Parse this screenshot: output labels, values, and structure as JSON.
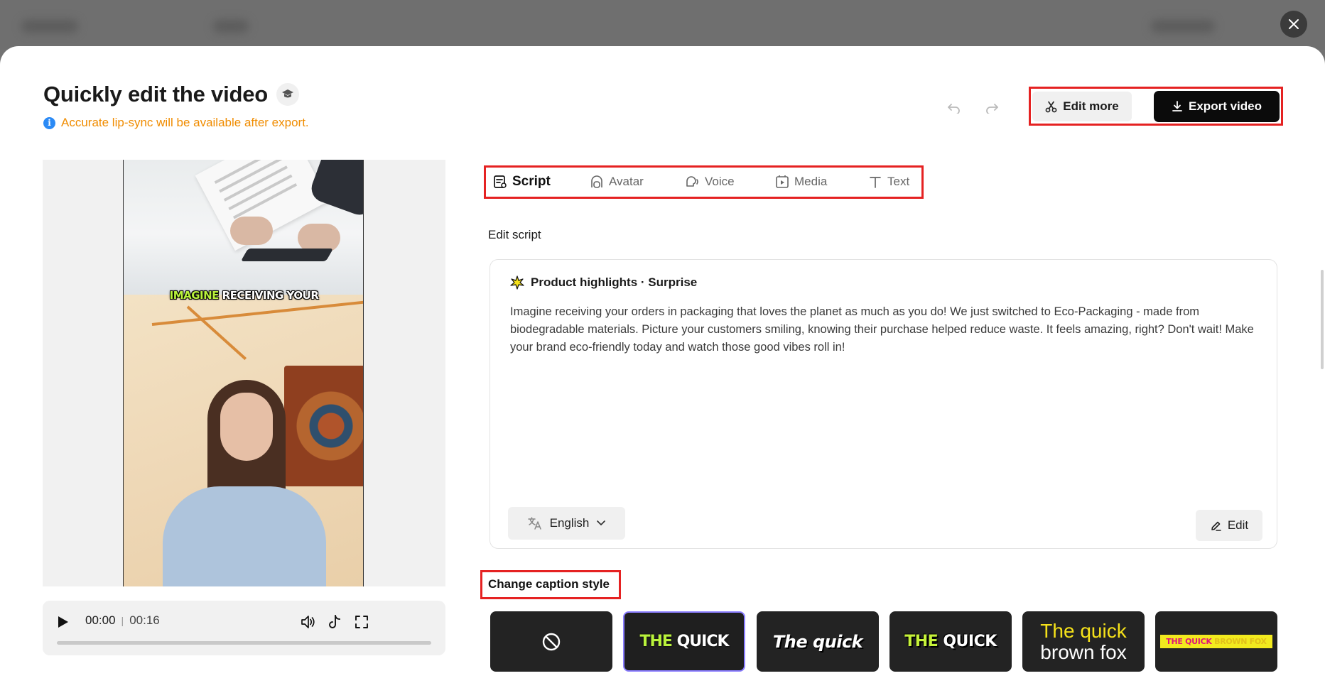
{
  "modal": {
    "title": "Quickly edit the video",
    "notice": "Accurate lip-sync will be available after export.",
    "actions": {
      "edit_more": "Edit more",
      "export": "Export video"
    }
  },
  "preview": {
    "caption_highlight": "IMAGINE",
    "caption_rest": " RECEIVING YOUR",
    "current_time": "00:00",
    "duration": "00:16",
    "progress": 0
  },
  "tabs": [
    {
      "label": "Script",
      "icon": "script-icon",
      "active": true
    },
    {
      "label": "Avatar",
      "icon": "avatar-icon",
      "active": false
    },
    {
      "label": "Voice",
      "icon": "voice-icon",
      "active": false
    },
    {
      "label": "Media",
      "icon": "media-icon",
      "active": false
    },
    {
      "label": "Text",
      "icon": "text-icon",
      "active": false
    }
  ],
  "script": {
    "section_label": "Edit script",
    "header": "Product highlights · Surprise",
    "body": "Imagine receiving your orders in packaging that loves the planet as much as you do! We just switched to Eco-Packaging - made from biodegradable materials. Picture your customers smiling, knowing their purchase helped reduce waste. It feels amazing, right? Don't wait! Make your brand eco-friendly today and watch those good vibes roll in!",
    "language": "English",
    "edit_label": "Edit"
  },
  "captions": {
    "label": "Change caption style",
    "styles": [
      {
        "name": "none",
        "text": ""
      },
      {
        "name": "style-1",
        "highlight": "THE",
        "rest": " QUICK",
        "selected": true
      },
      {
        "name": "style-2",
        "text": "The quick"
      },
      {
        "name": "style-3",
        "highlight": "THE",
        "rest": " QUICK"
      },
      {
        "name": "style-4",
        "highlight": "The quick",
        "rest": "brown fox"
      },
      {
        "name": "style-5",
        "highlight": "THE QUICK",
        "rest": " BROWN FOX"
      }
    ]
  },
  "colors": {
    "accent_red_box": "#e52222",
    "export_bg": "#0b0b0b",
    "notice": "#f08c00",
    "info": "#2b8af5",
    "caption_highlight": "#b9f23c"
  }
}
